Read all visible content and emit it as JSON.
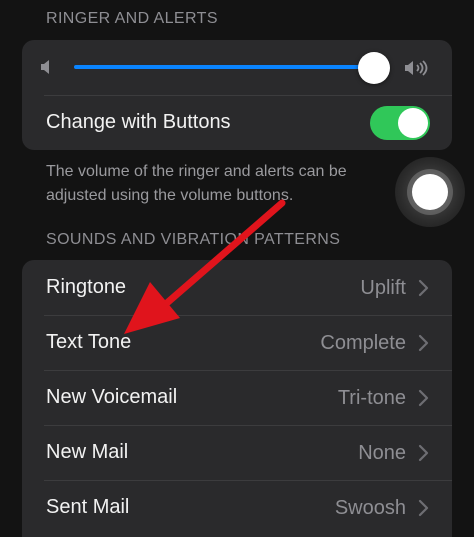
{
  "sections": {
    "ringer_header": "RINGER AND ALERTS",
    "sounds_header": "SOUNDS AND VIBRATION PATTERNS"
  },
  "ringer": {
    "volume_level": 0.92,
    "change_with_buttons_label": "Change with Buttons",
    "change_with_buttons_on": true,
    "footnote": "The volume of the ringer and alerts can be adjusted using the volume buttons."
  },
  "sounds": [
    {
      "label": "Ringtone",
      "value": "Uplift"
    },
    {
      "label": "Text Tone",
      "value": "Complete"
    },
    {
      "label": "New Voicemail",
      "value": "Tri-tone"
    },
    {
      "label": "New Mail",
      "value": "None"
    },
    {
      "label": "Sent Mail",
      "value": "Swoosh"
    }
  ],
  "colors": {
    "accent": "#0a84ff",
    "toggle_on": "#30c759",
    "annotation_arrow": "#e0141c"
  },
  "icons": {
    "volume_low": "speaker-icon",
    "volume_high": "speaker-wave-icon",
    "row_disclosure": "chevron-right-icon"
  }
}
